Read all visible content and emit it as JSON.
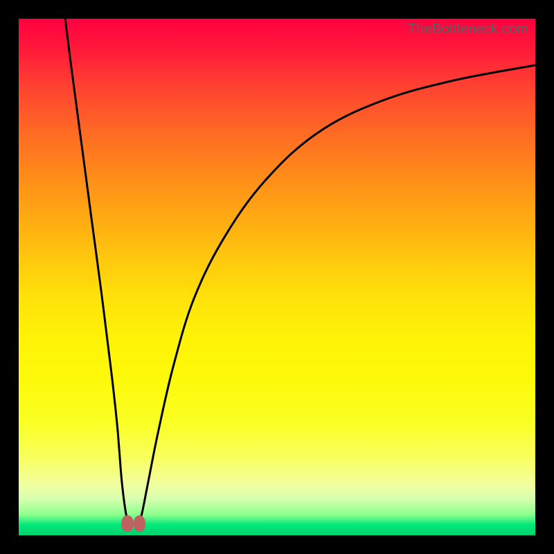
{
  "watermark": "TheBottleneck.com",
  "colors": {
    "frame": "#000000",
    "curve": "#000000",
    "blob": "#bf6161"
  },
  "chart_data": {
    "type": "line",
    "title": "",
    "xlabel": "",
    "ylabel": "",
    "xlim": [
      0,
      100
    ],
    "ylim": [
      0,
      100
    ],
    "annotations": [],
    "series": [
      {
        "name": "left-branch",
        "x": [
          9,
          10,
          12,
          14,
          16,
          18,
          19,
          19.5,
          20,
          20.8,
          21.5
        ],
        "y": [
          100,
          92,
          77,
          62,
          47,
          31,
          22,
          16,
          10,
          4,
          2
        ]
      },
      {
        "name": "right-branch",
        "x": [
          23.0,
          23.8,
          25,
          27,
          30,
          34,
          40,
          48,
          58,
          70,
          84,
          100
        ],
        "y": [
          2,
          4,
          10,
          20,
          33,
          46,
          58,
          69,
          78,
          84,
          88,
          91
        ]
      }
    ],
    "markers": [
      {
        "name": "blob-left",
        "cx": 21.0,
        "cy": 2.3,
        "r": 1.4
      },
      {
        "name": "blob-right",
        "cx": 23.4,
        "cy": 2.3,
        "r": 1.4
      }
    ]
  }
}
